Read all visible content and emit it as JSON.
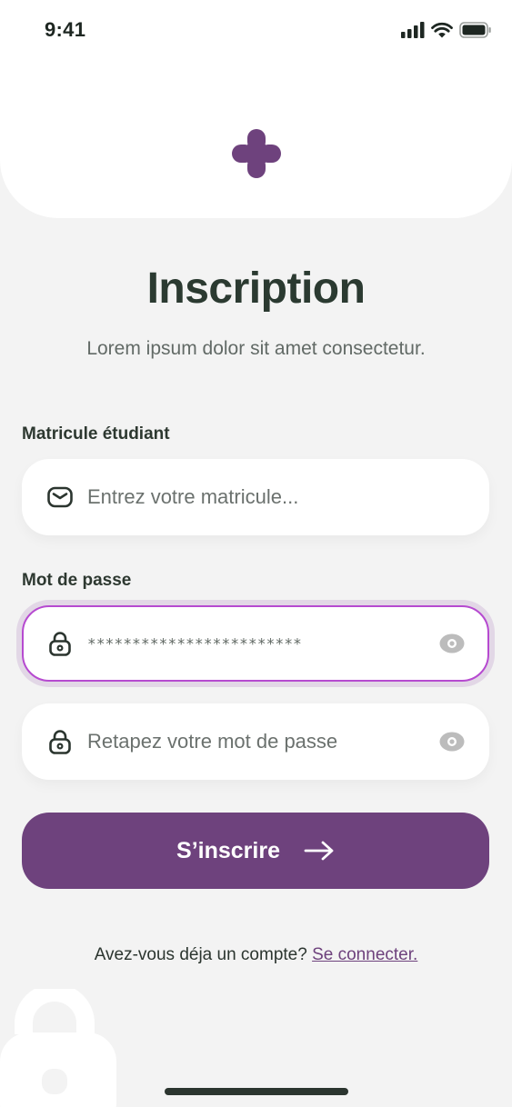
{
  "status_bar": {
    "time": "9:41",
    "icons": [
      "signal-icon",
      "wifi-icon",
      "battery-icon"
    ]
  },
  "header": {
    "logo": "flower-logo-icon"
  },
  "page": {
    "title": "Inscription",
    "subtitle": "Lorem ipsum dolor sit amet consectetur."
  },
  "form": {
    "matricule": {
      "label": "Matricule étudiant",
      "placeholder": "Entrez votre matricule...",
      "icon": "mail-icon"
    },
    "password": {
      "label": "Mot de passe",
      "value": "************************",
      "icon": "lock-icon",
      "toggle_icon": "eye-icon",
      "focused": true
    },
    "confirm_password": {
      "placeholder": "Retapez votre mot de passe",
      "icon": "lock-icon",
      "toggle_icon": "eye-icon"
    },
    "submit_label": "S’inscrire",
    "submit_icon": "arrow-right-icon"
  },
  "footer": {
    "prompt": "Avez-vous déja un compte?",
    "link": "Se connecter."
  },
  "colors": {
    "brand": "#6e427d",
    "focus_border": "#b64ad0",
    "focus_ring": "#e2d7e6",
    "background": "#f3f3f3",
    "heading": "#2b3a31"
  }
}
